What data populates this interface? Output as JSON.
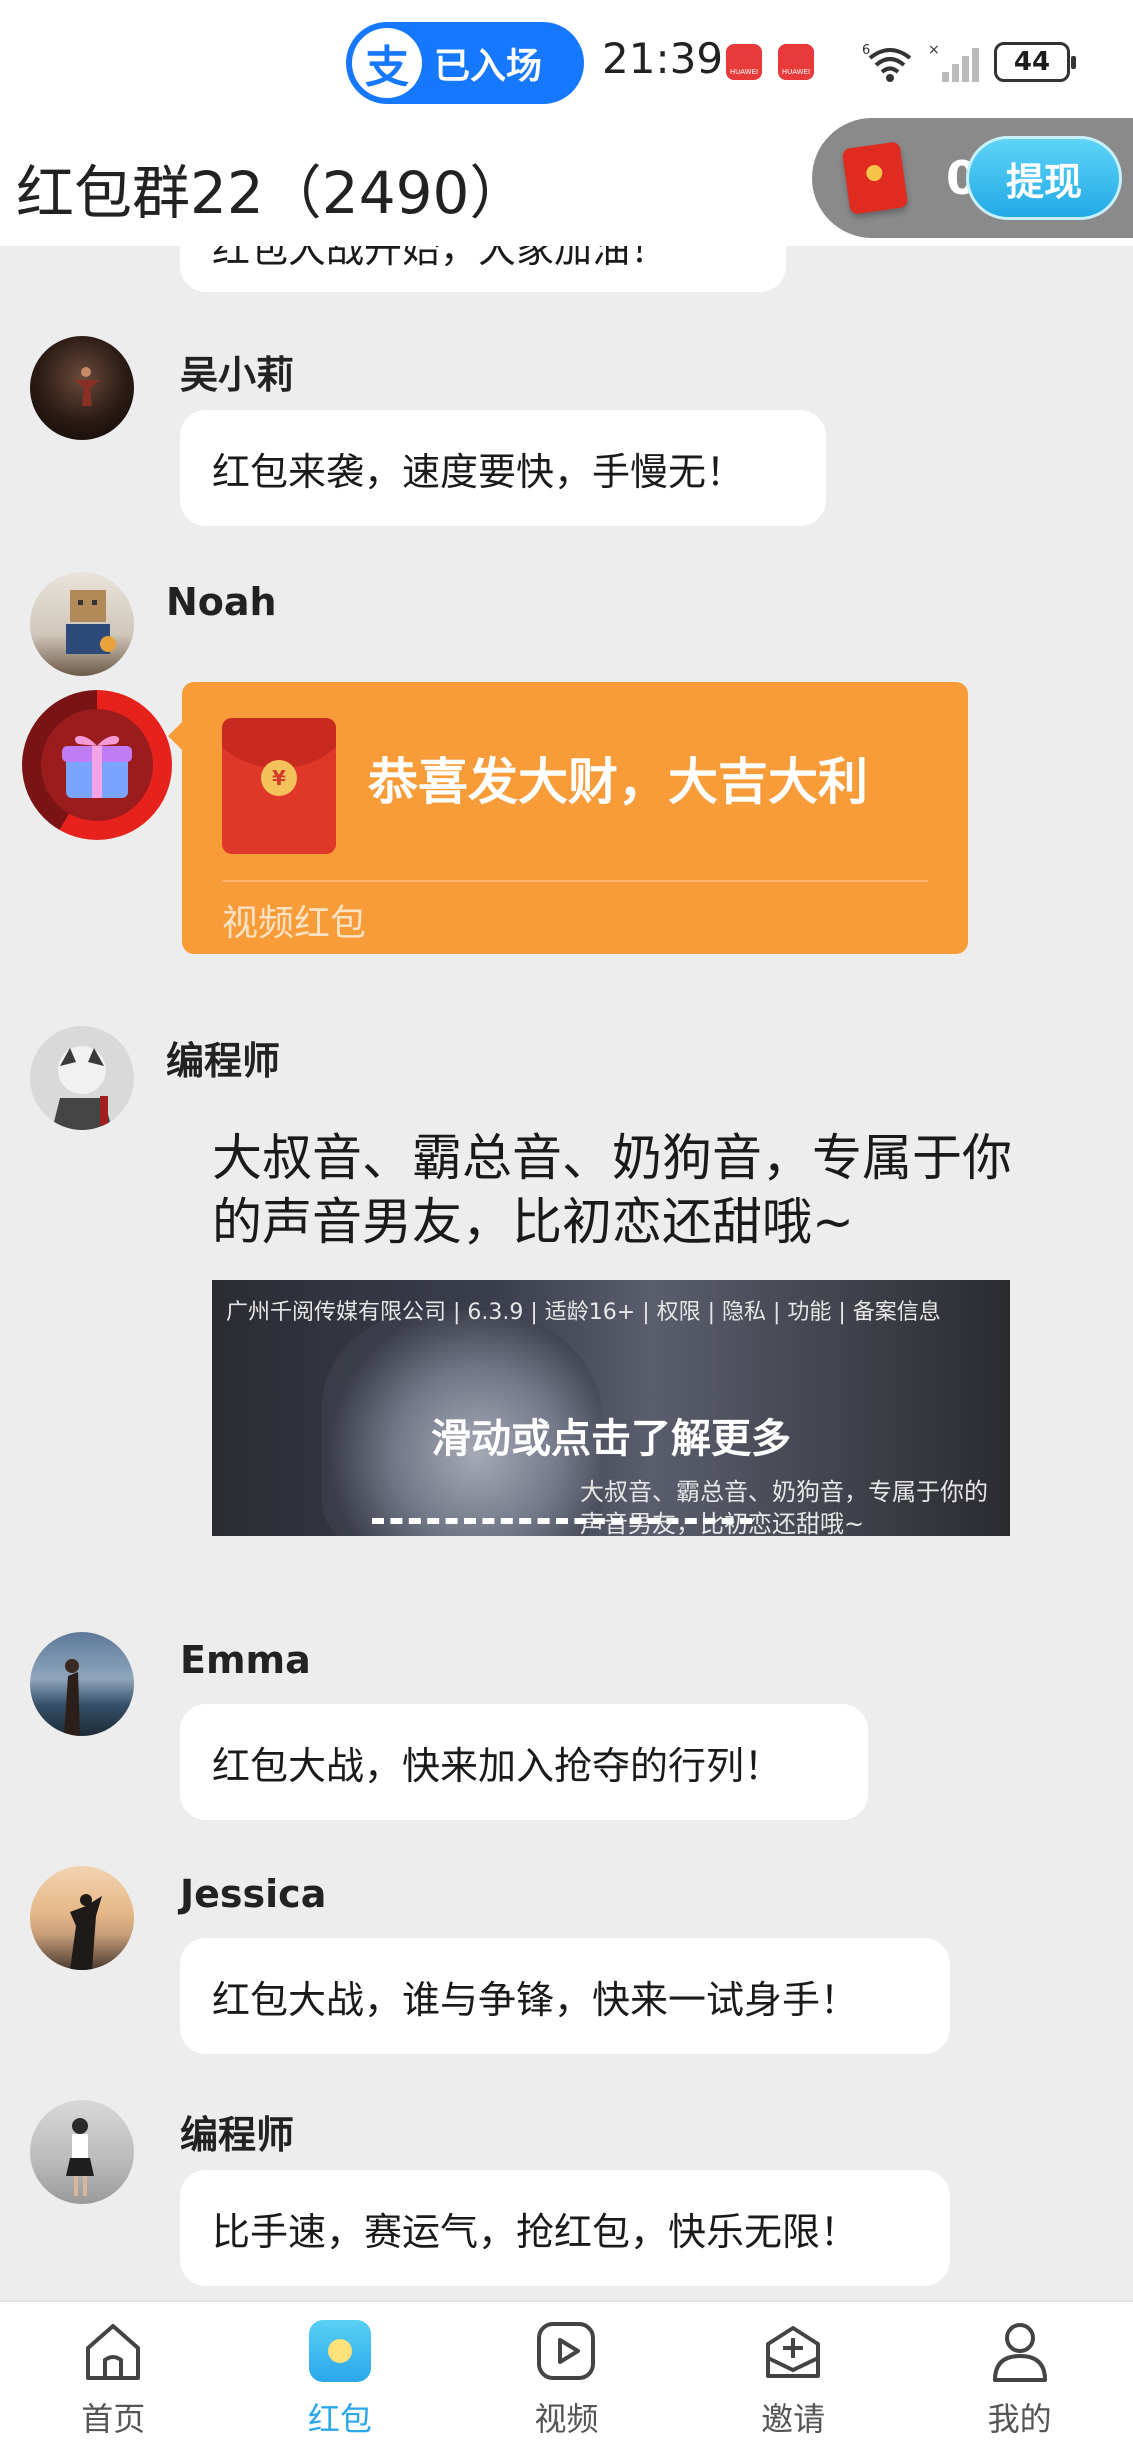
{
  "status_bar": {
    "alipay_logo": "支",
    "alipay_status": "已入场",
    "time": "21:39",
    "notif_badge": "HUAWEI",
    "battery": "44"
  },
  "header": {
    "title": "红包群22（2490）",
    "balance": "0",
    "withdraw": "提现"
  },
  "messages": [
    {
      "text": "红包大战开始，大家加油！"
    },
    {
      "name": "吴小莉",
      "text": "红包来袭，速度要快，手慢无！"
    },
    {
      "name": "Noah",
      "red_packet": {
        "title": "恭喜发大财，大吉大利",
        "label": "视频红包",
        "coin": "¥"
      }
    },
    {
      "name": "编程师",
      "ad": {
        "text": "大叔音、霸总音、奶狗音，专属于你的声音男友，比初恋还甜哦~",
        "info": "广州千阅传媒有限公司 | 6.3.9 | 适龄16+ | 权限 | 隐私 | 功能 | 备案信息",
        "cta": "滑动或点击了解更多",
        "sub": "大叔音、霸总音、奶狗音，专属于你的声音男友，比初恋还甜哦~"
      }
    },
    {
      "name": "Emma",
      "text": "红包大战，快来加入抢夺的行列！"
    },
    {
      "name": "Jessica",
      "text": "红包大战，谁与争锋，快来一试身手！"
    },
    {
      "name": "编程师",
      "text": "比手速，赛运气，抢红包，快乐无限！"
    }
  ],
  "tabs": [
    {
      "label": "首页",
      "icon": "home-icon"
    },
    {
      "label": "红包",
      "icon": "red-packet-icon"
    },
    {
      "label": "视频",
      "icon": "video-icon"
    },
    {
      "label": "邀请",
      "icon": "invite-icon"
    },
    {
      "label": "我的",
      "icon": "profile-icon"
    }
  ],
  "colors": {
    "accent": "#2aa7ea",
    "red_packet": "#f89c3a",
    "alipay": "#1677ff"
  }
}
